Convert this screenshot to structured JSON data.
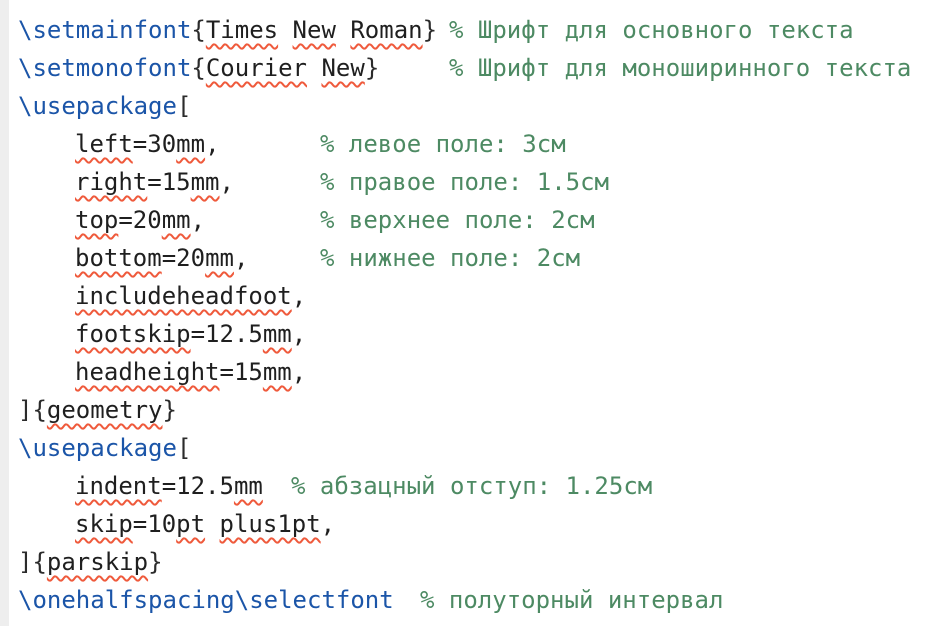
{
  "lines": [
    {
      "id": 1,
      "indent": false,
      "tokens": [
        {
          "t": "\\setmainfont",
          "c": "cmd"
        },
        {
          "t": "{",
          "c": "br"
        },
        {
          "t": "Times",
          "c": "txt",
          "sq": true
        },
        {
          "t": " ",
          "c": "txt"
        },
        {
          "t": "New",
          "c": "txt",
          "sq": true
        },
        {
          "t": " ",
          "c": "txt"
        },
        {
          "t": "Roman",
          "c": "txt",
          "sq": true
        },
        {
          "t": "}",
          "c": "br"
        }
      ],
      "comment": "% Шрифт для основного текста",
      "comment_col": 431
    },
    {
      "id": 2,
      "indent": false,
      "tokens": [
        {
          "t": "\\setmonofont",
          "c": "cmd"
        },
        {
          "t": "{",
          "c": "br"
        },
        {
          "t": "Courier",
          "c": "txt",
          "sq": true
        },
        {
          "t": " ",
          "c": "txt"
        },
        {
          "t": "New",
          "c": "txt",
          "sq": true
        },
        {
          "t": "}",
          "c": "br"
        }
      ],
      "comment": "% Шрифт для моноширинного текста",
      "comment_col": 431
    },
    {
      "id": 3,
      "indent": false,
      "tokens": [
        {
          "t": "\\usepackage",
          "c": "cmd"
        },
        {
          "t": "[",
          "c": "br"
        }
      ],
      "comment": "",
      "comment_col": 0
    },
    {
      "id": 4,
      "indent": true,
      "tokens": [
        {
          "t": "left",
          "c": "txt",
          "sq": true
        },
        {
          "t": "=30",
          "c": "txt"
        },
        {
          "t": "mm",
          "c": "txt",
          "sq": true
        },
        {
          "t": ",",
          "c": "txt"
        }
      ],
      "comment": "% левое поле: 3см",
      "comment_col": 302
    },
    {
      "id": 5,
      "indent": true,
      "tokens": [
        {
          "t": "right",
          "c": "txt",
          "sq": true
        },
        {
          "t": "=15",
          "c": "txt"
        },
        {
          "t": "mm",
          "c": "txt",
          "sq": true
        },
        {
          "t": ",",
          "c": "txt"
        }
      ],
      "comment": "% правое поле: 1.5см",
      "comment_col": 302
    },
    {
      "id": 6,
      "indent": true,
      "tokens": [
        {
          "t": "top",
          "c": "txt",
          "sq": true
        },
        {
          "t": "=20",
          "c": "txt"
        },
        {
          "t": "mm",
          "c": "txt",
          "sq": true
        },
        {
          "t": ",",
          "c": "txt"
        }
      ],
      "comment": "% верхнее поле: 2см",
      "comment_col": 302
    },
    {
      "id": 7,
      "indent": true,
      "tokens": [
        {
          "t": "bottom",
          "c": "txt",
          "sq": true
        },
        {
          "t": "=20",
          "c": "txt"
        },
        {
          "t": "mm",
          "c": "txt",
          "sq": true
        },
        {
          "t": ",",
          "c": "txt"
        }
      ],
      "comment": "% нижнее поле: 2см",
      "comment_col": 302
    },
    {
      "id": 8,
      "indent": true,
      "tokens": [
        {
          "t": "includeheadfoot",
          "c": "txt",
          "sq": true
        },
        {
          "t": ",",
          "c": "txt"
        }
      ],
      "comment": "",
      "comment_col": 0
    },
    {
      "id": 9,
      "indent": true,
      "tokens": [
        {
          "t": "footskip",
          "c": "txt",
          "sq": true
        },
        {
          "t": "=12.5",
          "c": "txt"
        },
        {
          "t": "mm",
          "c": "txt",
          "sq": true
        },
        {
          "t": ",",
          "c": "txt"
        }
      ],
      "comment": "",
      "comment_col": 0
    },
    {
      "id": 10,
      "indent": true,
      "tokens": [
        {
          "t": "headheight",
          "c": "txt",
          "sq": true
        },
        {
          "t": "=15",
          "c": "txt"
        },
        {
          "t": "mm",
          "c": "txt",
          "sq": true
        },
        {
          "t": ",",
          "c": "txt"
        }
      ],
      "comment": "",
      "comment_col": 0
    },
    {
      "id": 11,
      "indent": false,
      "tokens": [
        {
          "t": "]",
          "c": "br"
        },
        {
          "t": "{",
          "c": "br"
        },
        {
          "t": "geometry",
          "c": "txt",
          "sq": true
        },
        {
          "t": "}",
          "c": "br"
        }
      ],
      "comment": "",
      "comment_col": 0
    },
    {
      "id": 12,
      "indent": false,
      "tokens": [
        {
          "t": "\\usepackage",
          "c": "cmd"
        },
        {
          "t": "[",
          "c": "br"
        }
      ],
      "comment": "",
      "comment_col": 0
    },
    {
      "id": 13,
      "indent": true,
      "tokens": [
        {
          "t": "indent",
          "c": "txt",
          "sq": true
        },
        {
          "t": "=12.5",
          "c": "txt"
        },
        {
          "t": "mm",
          "c": "txt",
          "sq": true
        }
      ],
      "comment": "% абзацный отступ: 1.25см",
      "comment_col": 273
    },
    {
      "id": 14,
      "indent": true,
      "tokens": [
        {
          "t": "skip",
          "c": "txt",
          "sq": true
        },
        {
          "t": "=10",
          "c": "txt"
        },
        {
          "t": "pt",
          "c": "txt",
          "sq": true
        },
        {
          "t": " ",
          "c": "txt"
        },
        {
          "t": "plus1pt",
          "c": "txt",
          "sq": true
        },
        {
          "t": ",",
          "c": "txt"
        }
      ],
      "comment": "",
      "comment_col": 0
    },
    {
      "id": 15,
      "indent": false,
      "tokens": [
        {
          "t": "]",
          "c": "br"
        },
        {
          "t": "{",
          "c": "br"
        },
        {
          "t": "parskip",
          "c": "txt",
          "sq": true
        },
        {
          "t": "}",
          "c": "br"
        }
      ],
      "comment": "",
      "comment_col": 0
    },
    {
      "id": 16,
      "indent": false,
      "tokens": [
        {
          "t": "\\onehalfspacing",
          "c": "cmd"
        },
        {
          "t": "\\selectfont",
          "c": "cmd"
        }
      ],
      "comment": "% полуторный интервал",
      "comment_col": 402
    }
  ],
  "colors": {
    "command": "#1b55a8",
    "comment": "#4d8a63",
    "text": "#1f1f1f",
    "spellcheck_squiggle": "#ef5a3c",
    "gutter": "#eeeeee"
  }
}
